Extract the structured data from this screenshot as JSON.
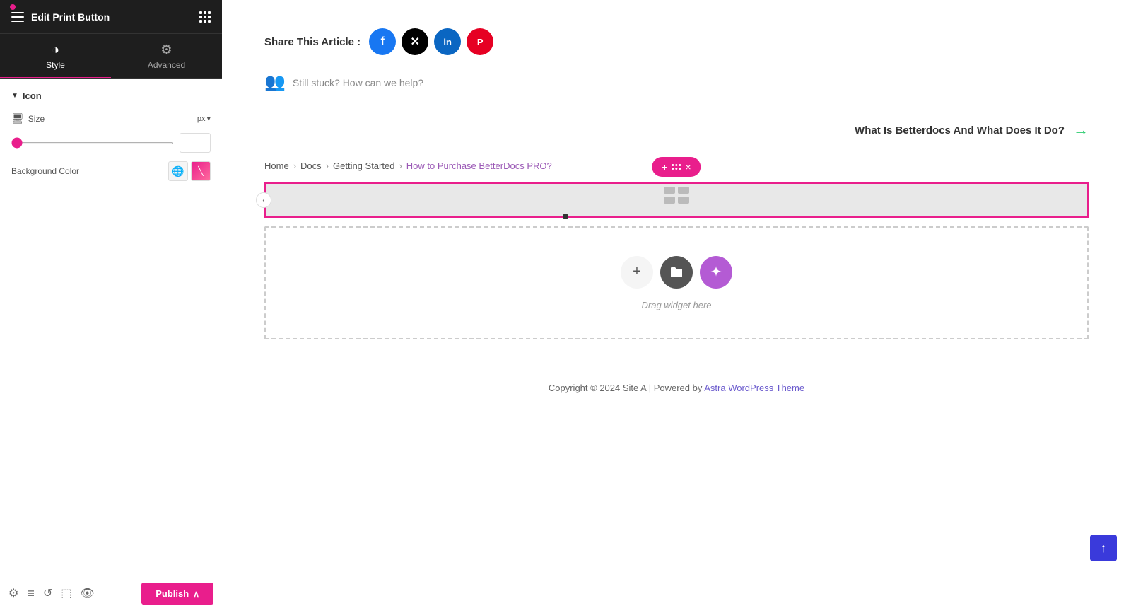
{
  "sidebar": {
    "title": "Edit Print Button",
    "tabs": [
      {
        "id": "style",
        "label": "Style",
        "active": true
      },
      {
        "id": "advanced",
        "label": "Advanced",
        "active": false
      }
    ],
    "sections": [
      {
        "id": "icon",
        "label": "Icon",
        "expanded": true,
        "fields": [
          {
            "id": "size",
            "label": "Size",
            "type": "slider",
            "value": 0,
            "min": 0,
            "max": 100,
            "unit": "px"
          },
          {
            "id": "background-color",
            "label": "Background Color",
            "type": "color"
          }
        ]
      }
    ],
    "footer": {
      "publish_label": "Publish",
      "icons": [
        "settings",
        "layers",
        "history",
        "template",
        "eye"
      ]
    }
  },
  "main": {
    "share": {
      "label": "Share This Article :",
      "socials": [
        {
          "id": "facebook",
          "symbol": "f",
          "class": "social-fb"
        },
        {
          "id": "twitter-x",
          "symbol": "✕",
          "class": "social-x"
        },
        {
          "id": "linkedin",
          "symbol": "in",
          "class": "social-li"
        },
        {
          "id": "pinterest",
          "symbol": "P",
          "class": "social-pi"
        }
      ]
    },
    "still_stuck": "Still stuck? How can we help?",
    "next_article": {
      "label": "What Is Betterdocs And What Does It Do?"
    },
    "breadcrumb": [
      {
        "label": "Home",
        "active": false
      },
      {
        "label": "Docs",
        "active": false
      },
      {
        "label": "Getting Started",
        "active": false
      },
      {
        "label": "How to Purchase BetterDocs PRO?",
        "active": true
      }
    ],
    "widget_area": {
      "drag_label": "Drag widget here"
    },
    "footer": {
      "copyright": "Copyright © 2024 Site A | Powered by ",
      "link_text": "Astra WordPress Theme",
      "link_url": "#"
    }
  },
  "icons": {
    "hamburger": "☰",
    "grid": "⊞",
    "style_icon": "◑",
    "advanced_icon": "⚙",
    "monitor": "🖥",
    "globe": "🌐",
    "brush": "🖌",
    "settings": "⚙",
    "layers": "≡",
    "history": "↺",
    "template": "⬚",
    "eye": "👁",
    "chevron_up": "∧",
    "chevron_left": "‹",
    "arrow_right": "→",
    "plus": "+",
    "close": "×",
    "scroll_top": "↑"
  }
}
